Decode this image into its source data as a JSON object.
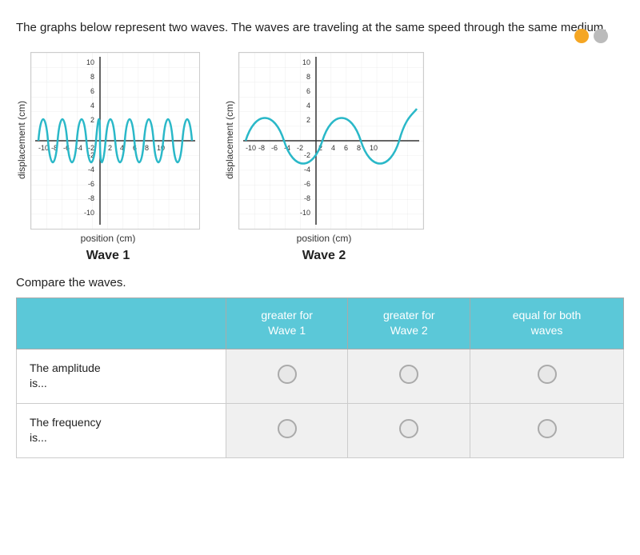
{
  "icons": {
    "circle1_color": "#f5a623",
    "circle2_color": "#bbb"
  },
  "intro": {
    "text": "The graphs below represent two waves. The waves are traveling at the same speed through the same medium."
  },
  "graphs": [
    {
      "id": "wave1",
      "y_label": "displacement (cm)",
      "x_label": "position (cm)",
      "title": "Wave 1"
    },
    {
      "id": "wave2",
      "y_label": "displacement (cm)",
      "x_label": "position (cm)",
      "title": "Wave 2"
    }
  ],
  "compare": {
    "label": "Compare the waves.",
    "headers": {
      "col0": "",
      "col1_line1": "greater for",
      "col1_line2": "Wave 1",
      "col2_line1": "greater for",
      "col2_line2": "Wave 2",
      "col3_line1": "equal for both",
      "col3_line2": "waves"
    },
    "rows": [
      {
        "label_line1": "The amplitude",
        "label_line2": "is..."
      },
      {
        "label_line1": "The frequency",
        "label_line2": "is..."
      }
    ]
  }
}
